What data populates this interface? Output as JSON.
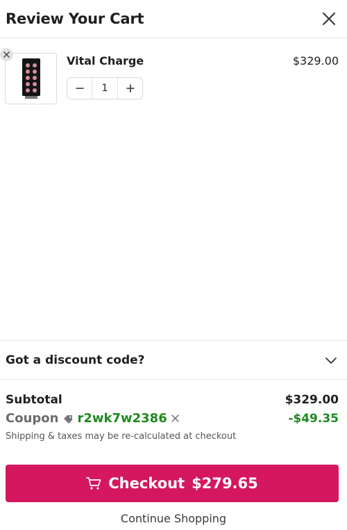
{
  "header": {
    "title": "Review Your Cart",
    "close_icon": "close-icon"
  },
  "cart": {
    "items": [
      {
        "name": "Vital Charge",
        "price": "$329.00",
        "quantity": "1",
        "image_icon": "product-thumbnail"
      }
    ]
  },
  "discount": {
    "label": "Got a discount code?",
    "icon": "chevron-down-icon"
  },
  "summary": {
    "subtotal_label": "Subtotal",
    "subtotal_value": "$329.00",
    "coupon_label": "Coupon",
    "coupon_code": "r2wk7w2386",
    "coupon_amount": "-$49.35",
    "note": "Shipping & taxes may be re-calculated at checkout"
  },
  "checkout": {
    "label": "Checkout",
    "amount": "$279.65"
  },
  "continue_label": "Continue Shopping",
  "colors": {
    "accent": "#d4175f",
    "discount_green": "#1e8a1e"
  }
}
